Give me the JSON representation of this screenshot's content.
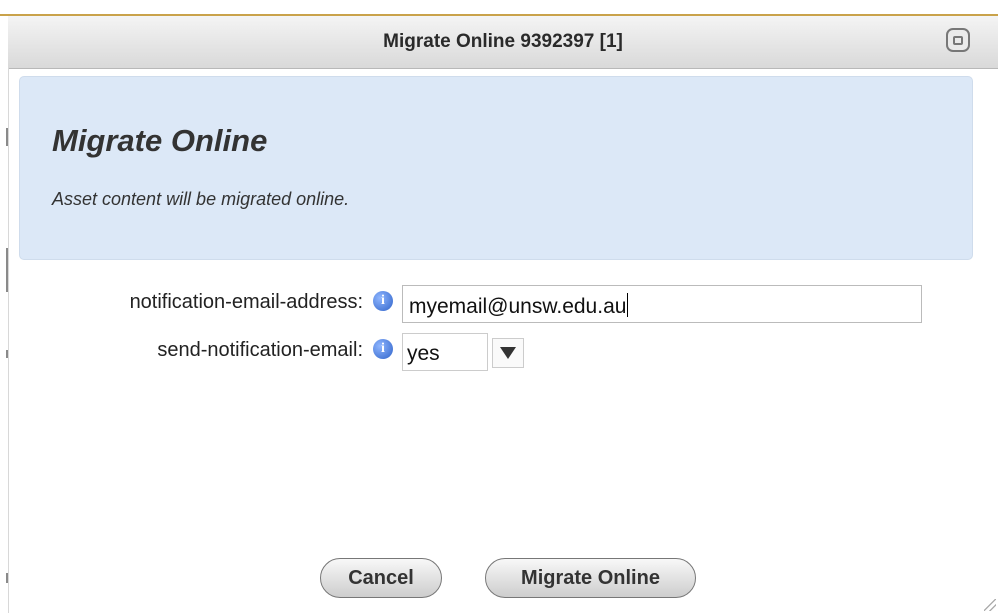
{
  "window": {
    "title": "Migrate Online 9392397 [1]"
  },
  "header": {
    "heading": "Migrate Online",
    "description": "Asset content will be migrated online."
  },
  "form": {
    "email": {
      "label": "notification-email-address:",
      "value": "myemail@unsw.edu.au",
      "icon": "info-icon"
    },
    "send_notification": {
      "label": "send-notification-email:",
      "selected": "yes",
      "icon": "info-icon"
    }
  },
  "buttons": {
    "cancel": "Cancel",
    "migrate": "Migrate Online"
  },
  "colors": {
    "header_background": "#dce8f7",
    "info_icon": "#2f63c9",
    "accent_line": "#c9a24a"
  }
}
